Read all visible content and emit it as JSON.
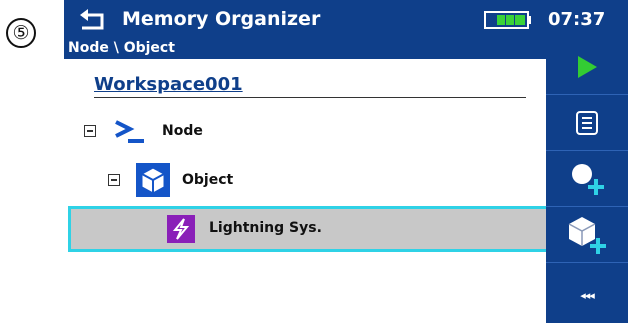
{
  "step": {
    "number": "⑤"
  },
  "titlebar": {
    "title": "Memory Organizer",
    "time": "07:37",
    "back_icon": "back-arrow-icon",
    "battery_icon": "battery-icon"
  },
  "breadcrumb": {
    "path": "Node \\ Object"
  },
  "tree": {
    "workspace": "Workspace001",
    "node": {
      "label": "Node",
      "icon": "prompt-chevron-icon"
    },
    "object": {
      "label": "Object",
      "icon": "cube-icon"
    },
    "selected": {
      "label": "Lightning Sys.",
      "icon": "lightning-icon"
    }
  },
  "sidebar": {
    "buttons": [
      {
        "name": "play-button",
        "icon": "play-icon"
      },
      {
        "name": "list-button",
        "icon": "list-icon"
      },
      {
        "name": "add-node-button",
        "icon": "add-node-icon"
      },
      {
        "name": "add-object-button",
        "icon": "add-object-icon"
      },
      {
        "name": "more-button",
        "label": "◂◂◂"
      }
    ]
  },
  "colors": {
    "primary": "#0f3f8a",
    "selection_border": "#2fd2e6",
    "selection_bg": "#c8c8c8",
    "play_green": "#33cc33",
    "lightning_purple": "#8a1fb8"
  }
}
